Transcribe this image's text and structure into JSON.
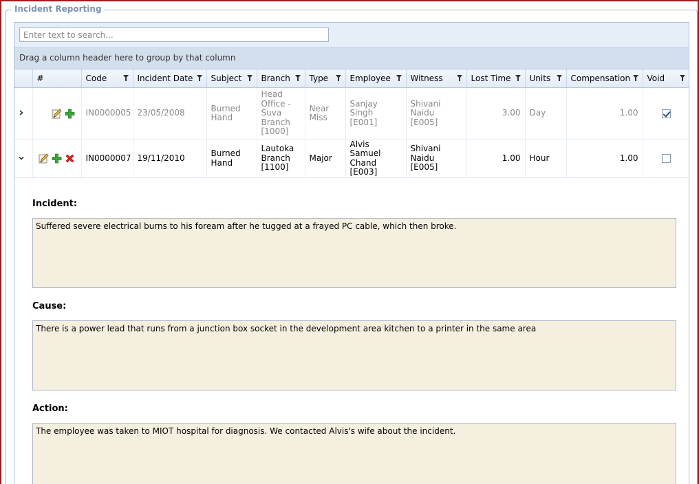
{
  "section": {
    "title": "Incident Reporting"
  },
  "search": {
    "placeholder": "Enter text to search..."
  },
  "group_panel": {
    "text": "Drag a column header here to group by that column"
  },
  "columns": [
    "#",
    "Code",
    "Incident Date",
    "Subject",
    "Branch",
    "Type",
    "Employee",
    "Witness",
    "Lost Time",
    "Units",
    "Compensation",
    "Void"
  ],
  "rows": [
    {
      "code": "IN0000005",
      "date": "23/05/2008",
      "subject": "Burned Hand",
      "branch": "Head Office - Suva Branch [1000]",
      "type": "Near Miss",
      "employee": "Sanjay Singh [E001]",
      "witness": "Shivani Naidu [E005]",
      "lost_time": "3.00",
      "units": "Day",
      "compensation": "1.00",
      "void": true,
      "expanded": false
    },
    {
      "code": "IN0000007",
      "date": "19/11/2010",
      "subject": "Burned Hand",
      "branch": "Lautoka Branch [1100]",
      "type": "Major",
      "employee": "Alvis Samuel Chand [E003]",
      "witness": "Shivani Naidu [E005]",
      "lost_time": "1.00",
      "units": "Hour",
      "compensation": "1.00",
      "void": false,
      "expanded": true
    }
  ],
  "detail": {
    "incident_label": "Incident:",
    "incident_text": "Suffered severe electrical burns to his foream after he tugged at a frayed PC cable, which then broke.",
    "cause_label": "Cause:",
    "cause_text": "There is a power lead that runs from a junction box socket in the development  area kitchen to a printer in the same area",
    "action_label": "Action:",
    "action_text": "The employee was taken to MIOT hospital for diagnosis. We contacted Alvis's wife about the incident."
  },
  "icons": {
    "edit": "edit-pencil-icon",
    "add": "add-plus-icon",
    "delete": "delete-x-icon",
    "filter": "filter-funnel-icon"
  },
  "colors": {
    "frame": "#a01c1c",
    "legend": "#7b93ad",
    "memo_bg": "#f5efdf",
    "header_bg": "#e3ebf6"
  }
}
